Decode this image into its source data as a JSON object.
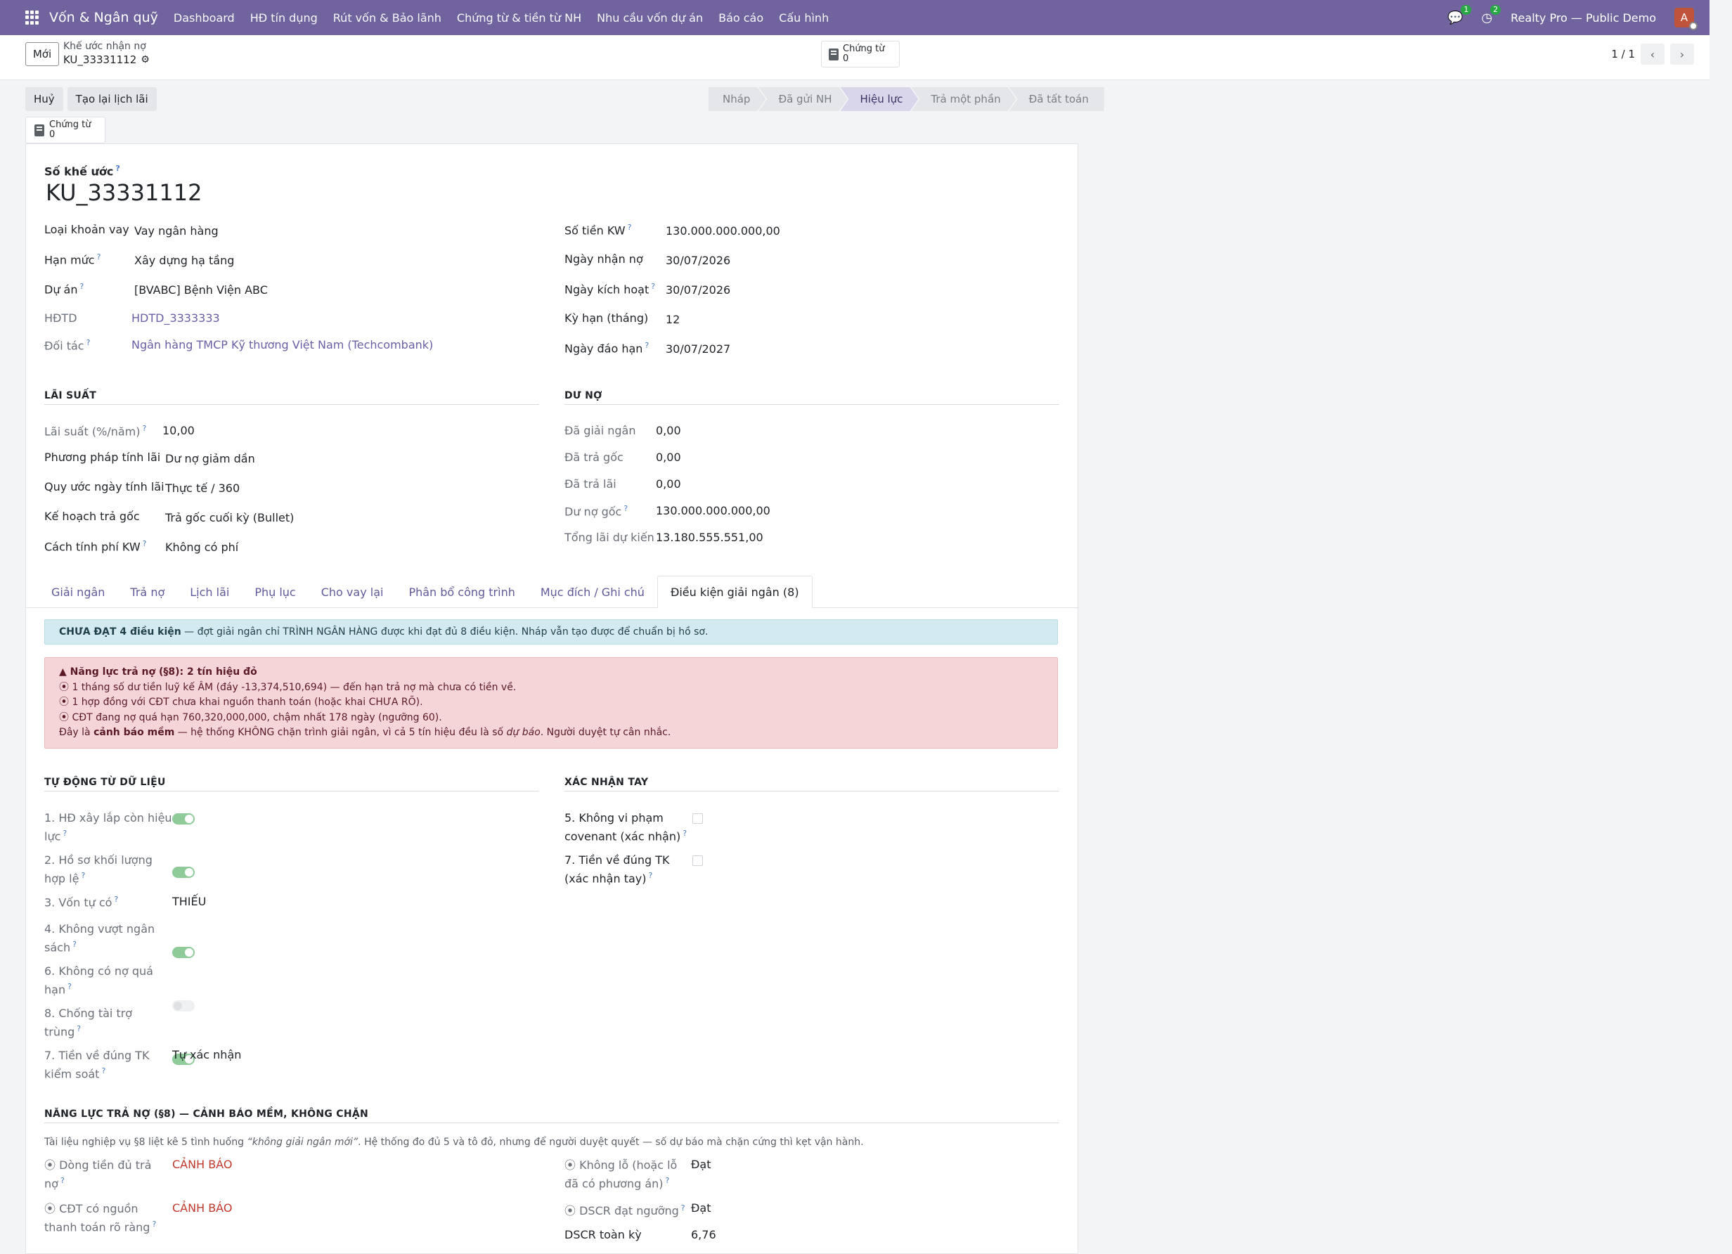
{
  "nav": {
    "brand": "Vốn & Ngân quỹ",
    "menu": [
      "Dashboard",
      "HĐ tín dụng",
      "Rút vốn & Bảo lãnh",
      "Chứng từ & tiền từ NH",
      "Nhu cầu vốn dự án",
      "Báo cáo",
      "Cấu hình"
    ],
    "chat_count": "1",
    "activity_count": "2",
    "company": "Realty Pro — Public Demo",
    "avatar": "A"
  },
  "control": {
    "new_label": "Mới",
    "breadcrumb_parent": "Khế ước nhận nợ",
    "breadcrumb_current": "KU_33331112",
    "smart_label": "Chứng từ",
    "smart_count": "0",
    "pager": "1 / 1"
  },
  "actions": {
    "cancel": "Huỷ",
    "regen": "Tạo lại lịch lãi"
  },
  "status": [
    "Nháp",
    "Đã gửi NH",
    "Hiệu lực",
    "Trả một phần",
    "Đã tất toán"
  ],
  "status_active": "Hiệu lực",
  "form": {
    "number_label": "Số khế ước",
    "number": "KU_33331112",
    "left_fields": [
      {
        "label": "Loại khoản vay",
        "value": "Vay ngân hàng"
      },
      {
        "label": "Hạn mức",
        "value": "Xây dựng hạ tầng"
      },
      {
        "label": "Dự án",
        "value": "[BVABC] Bệnh Viện ABC"
      },
      {
        "label": "HĐTD",
        "value": "HDTD_3333333"
      },
      {
        "label": "Đối tác",
        "value": "Ngân hàng TMCP Kỹ thương Việt Nam (Techcombank)"
      }
    ],
    "right_fields": [
      {
        "label": "Số tiền KW",
        "value": "130.000.000.000,00"
      },
      {
        "label": "Ngày nhận nợ",
        "value": "30/07/2026"
      },
      {
        "label": "Ngày kích hoạt",
        "value": "30/07/2026"
      },
      {
        "label": "Kỳ hạn (tháng)",
        "value": "12"
      },
      {
        "label": "Ngày đáo hạn",
        "value": "30/07/2027"
      }
    ],
    "interest_title": "LÃI SUẤT",
    "interest": [
      {
        "label": "Lãi suất (%/năm)",
        "value": "10,00"
      },
      {
        "label": "Phương pháp tính lãi",
        "value": "Dư nợ giảm dần"
      },
      {
        "label": "Quy ước ngày tính lãi",
        "value": "Thực tế / 360"
      },
      {
        "label": "Kế hoạch trả gốc",
        "value": "Trả gốc cuối kỳ (Bullet)"
      },
      {
        "label": "Cách tính phí KW",
        "value": "Không có phí"
      }
    ],
    "debt_title": "DƯ NỢ",
    "debt": [
      {
        "label": "Đã giải ngân",
        "value": "0,00"
      },
      {
        "label": "Đã trả gốc",
        "value": "0,00"
      },
      {
        "label": "Đã trả lãi",
        "value": "0,00"
      },
      {
        "label": "Dư nợ gốc",
        "value": "130.000.000.000,00"
      },
      {
        "label": "Tổng lãi dự kiến",
        "value": "13.180.555.551,00"
      }
    ]
  },
  "tabs": [
    "Giải ngân",
    "Trả nợ",
    "Lịch lãi",
    "Phụ lục",
    "Cho vay lại",
    "Phân bổ công trình",
    "Mục đích / Ghi chú",
    "Điều kiện giải ngân (8)"
  ],
  "info": {
    "bold": "CHƯA ĐẠT 4 điều kiện",
    "rest": " — đợt giải ngân chỉ TRÌNH NGÂN HÀNG được khi đạt đủ 8 điều kiện. Nháp vẫn tạo được để chuẩn bị hồ sơ."
  },
  "danger": {
    "title": "Năng lực trả nợ (§8): 2 tín hiệu đỏ",
    "lines": [
      "1 tháng số dư tiền luỹ kế ÂM (đáy -13,374,510,694) — đến hạn trả nợ mà chưa có tiền về.",
      "1 hợp đồng với CĐT chưa khai nguồn thanh toán (hoặc khai CHƯA RÕ).",
      "CĐT đang nợ quá hạn 760,320,000,000, chậm nhất 178 ngày (ngưỡng 60)."
    ],
    "foot_a": "Đây là ",
    "foot_b": "cảnh báo mềm",
    "foot_c": " — hệ thống KHÔNG chặn trình giải ngân, vì cả 5 tín hiệu đều là số ",
    "foot_d": "dự báo",
    "foot_e": ". Người duyệt tự cân nhắc."
  },
  "auto": {
    "title": "TỰ ĐỘNG TỪ DỮ LIỆU",
    "items": [
      {
        "l1": "1. HĐ xây lắp còn hiệu",
        "l2": "lực",
        "value": ""
      },
      {
        "l1": "2. Hồ sơ khối lượng",
        "l2": "hợp lệ",
        "value": ""
      },
      {
        "l1": "3. Vốn tự có",
        "l2": "",
        "value": "THIẾU"
      },
      {
        "l1": "4. Không vượt ngân",
        "l2": "sách",
        "value": ""
      },
      {
        "l1": "6. Không có nợ quá",
        "l2": "hạn",
        "value": ""
      },
      {
        "l1": "8. Chống tài trợ",
        "l2": "trùng",
        "value": ""
      },
      {
        "l1": "7. Tiền về đúng TK",
        "l2": "kiểm soát",
        "value": "Tự xác nhận"
      }
    ]
  },
  "manual": {
    "title": "XÁC NHẬN TAY",
    "items": [
      {
        "l1": "5. Không vi phạm",
        "l2": "covenant (xác nhận)"
      },
      {
        "l1": "7. Tiền về đúng TK",
        "l2": "(xác nhận tay)"
      }
    ]
  },
  "capacity": {
    "title": "NĂNG LỰC TRẢ NỢ (§8) — CẢNH BÁO MỀM, KHÔNG CHẶN",
    "desc_a": "Tài liệu nghiệp vụ §8 liệt kê 5 tình huống ",
    "desc_b": "“không giải ngân mới”",
    "desc_c": ". Hệ thống đo đủ 5 và tô đỏ, nhưng để người duyệt quyết — số dự báo mà chặn cứng thì kẹt vận hành.",
    "left": [
      {
        "l1": "⦿ Dòng tiền đủ trả",
        "l2": "nợ",
        "value": "CẢNH BÁO"
      },
      {
        "l1": "⦿ CĐT có nguồn",
        "l2": "thanh toán rõ ràng",
        "value": "CẢNH BÁO"
      }
    ],
    "right": [
      {
        "l1": "⦿ Không lỗ (hoặc lỗ",
        "l2": "đã có phương án)",
        "value": "Đạt"
      },
      {
        "l1": "⦿ DSCR đạt ngưỡng",
        "l2": "",
        "value": "Đạt"
      },
      {
        "l1": "DSCR toàn kỳ",
        "l2": "",
        "value": "6,76"
      }
    ]
  }
}
